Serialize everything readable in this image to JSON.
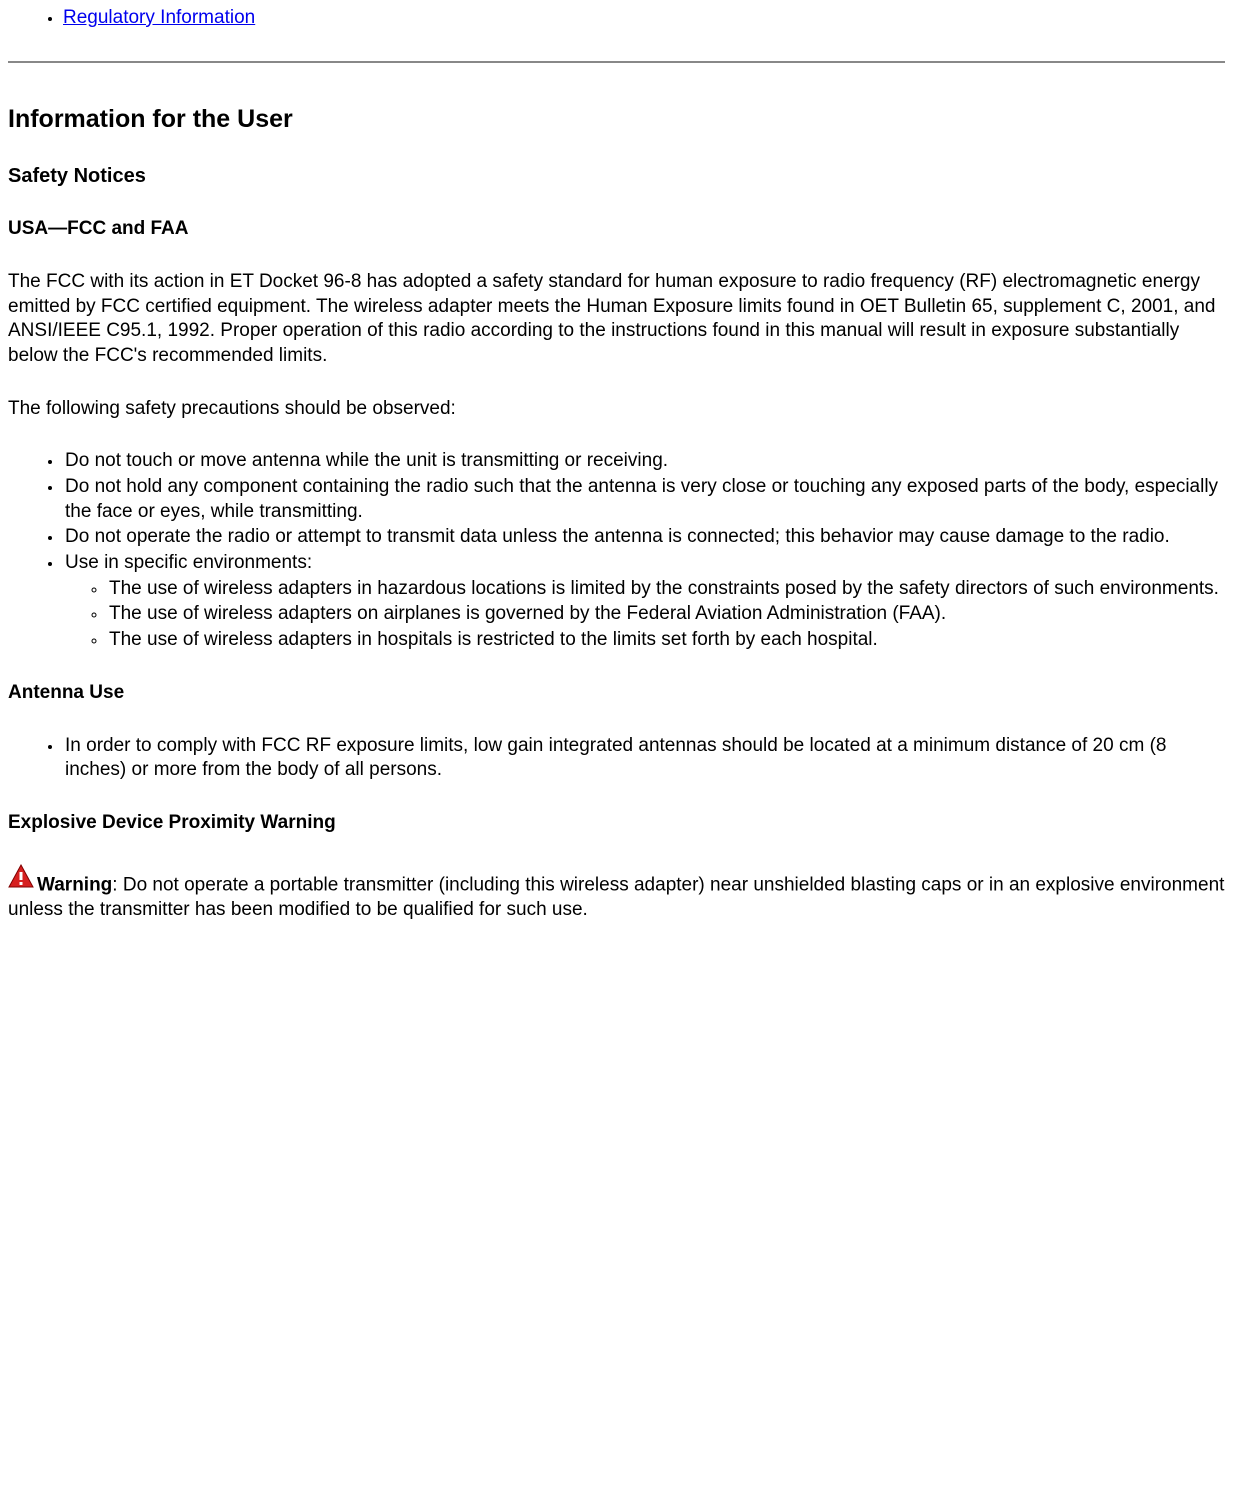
{
  "nav": {
    "regulatory_link": "Regulatory Information"
  },
  "heading_main": "Information for the User",
  "heading_safety": "Safety Notices",
  "heading_usa": "USA—FCC and FAA",
  "para_fcc": "The FCC with its action in ET Docket 96-8 has adopted a safety standard for human exposure to radio frequency (RF) electromagnetic energy emitted by FCC certified equipment. The wireless adapter meets the Human Exposure limits found in OET Bulletin 65, supplement C, 2001, and ANSI/IEEE C95.1, 1992. Proper operation of this radio according to the instructions found in this manual will result in exposure substantially below the FCC's recommended limits.",
  "para_precautions": "The following safety precautions should be observed:",
  "precautions": [
    "Do not touch or move antenna while the unit is transmitting or receiving.",
    "Do not hold any component containing the radio such that the antenna is very close or touching any exposed parts of the body, especially the face or eyes, while transmitting.",
    "Do not operate the radio or attempt to transmit data unless the antenna is connected; this behavior may cause damage to the radio.",
    "Use in specific environments:"
  ],
  "environments": [
    "The use of wireless adapters in hazardous locations is limited by the constraints posed by the safety directors of such environments.",
    "The use of wireless adapters on airplanes is governed by the Federal Aviation Administration (FAA).",
    "The use of wireless adapters in hospitals is restricted to the limits set forth by each hospital."
  ],
  "heading_antenna": "Antenna Use",
  "antenna_items": [
    "In order to comply with FCC RF exposure limits, low gain integrated antennas should be located at a minimum distance of 20 cm (8 inches) or more from the body of all persons."
  ],
  "heading_explosive": "Explosive Device Proximity Warning",
  "warning_label": "Warning",
  "warning_text": ": Do not operate a portable transmitter (including this wireless adapter) near unshielded blasting caps or in an explosive environment unless the transmitter has been modified to be qualified for such use."
}
